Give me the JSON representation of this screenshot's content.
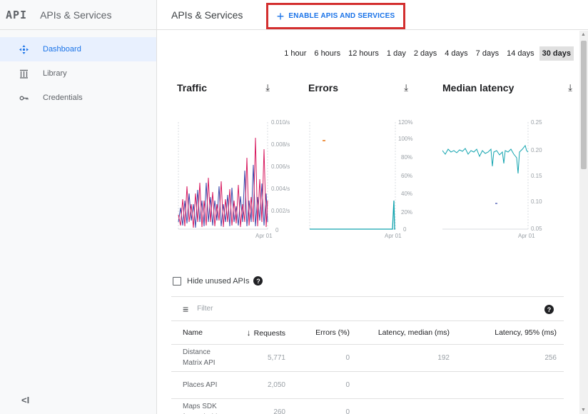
{
  "sidebar": {
    "logo": "API",
    "title": "APIs & Services",
    "items": [
      {
        "label": "Dashboard",
        "icon": "dashboard-icon",
        "active": true
      },
      {
        "label": "Library",
        "icon": "library-icon",
        "active": false
      },
      {
        "label": "Credentials",
        "icon": "key-icon",
        "active": false
      }
    ],
    "collapse_label": "<I"
  },
  "header": {
    "title": "APIs & Services",
    "enable_label": "ENABLE APIS AND SERVICES"
  },
  "time_range": {
    "options": [
      "1 hour",
      "6 hours",
      "12 hours",
      "1 day",
      "2 days",
      "4 days",
      "7 days",
      "14 days",
      "30 days"
    ],
    "selected": "30 days"
  },
  "charts": {
    "traffic": {
      "title": "Traffic",
      "ticks": [
        "0.010/s",
        "0.008/s",
        "0.006/s",
        "0.004/s",
        "0.002/s",
        "0"
      ],
      "xlabel": "Apr 01"
    },
    "errors": {
      "title": "Errors",
      "ticks": [
        "120%",
        "100%",
        "80%",
        "60%",
        "40%",
        "20%",
        "0"
      ],
      "xlabel": "Apr 01"
    },
    "latency": {
      "title": "Median latency",
      "ticks": [
        "0.25",
        "0.20",
        "0.15",
        "0.10",
        "0.05"
      ],
      "xlabel": "Apr 01"
    }
  },
  "hide_unused_label": "Hide unused APIs",
  "filter_placeholder": "Filter",
  "table": {
    "columns": [
      "Name",
      "Requests",
      "Errors (%)",
      "Latency, median (ms)",
      "Latency, 95% (ms)"
    ],
    "rows": [
      {
        "name": "Distance Matrix API",
        "requests": "5,771",
        "errors": "0",
        "latency_median": "192",
        "latency_95": "256"
      },
      {
        "name": "Places API",
        "requests": "2,050",
        "errors": "0",
        "latency_median": "",
        "latency_95": ""
      },
      {
        "name": "Maps SDK for Android",
        "requests": "260",
        "errors": "0",
        "latency_median": "",
        "latency_95": ""
      }
    ]
  },
  "colors": {
    "accent": "#1a73e8",
    "highlight_border": "#d32f2f",
    "series_pink": "#d81b60",
    "series_navy": "#3949ab",
    "series_teal": "#12a4af",
    "series_orange": "#e8710a"
  }
}
